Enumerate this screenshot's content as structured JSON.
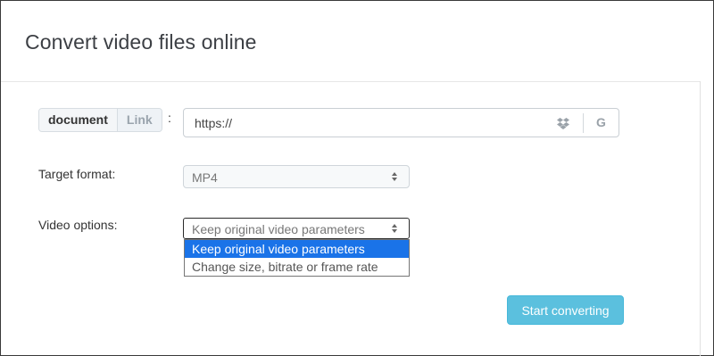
{
  "page": {
    "title": "Convert video files online"
  },
  "source": {
    "tabs": [
      {
        "label": "document"
      },
      {
        "label": "Link"
      }
    ],
    "colon": ":",
    "url_value": "https://",
    "drive_letter": "G"
  },
  "target_format": {
    "label": "Target format:",
    "selected": "MP4"
  },
  "video_options": {
    "label": "Video options:",
    "selected": "Keep original video parameters",
    "options": [
      "Keep original video parameters",
      "Change size, bitrate or frame rate"
    ]
  },
  "actions": {
    "start_label": "Start converting"
  },
  "colors": {
    "accent": "#5bc0de",
    "option_highlight": "#1a73e8"
  }
}
